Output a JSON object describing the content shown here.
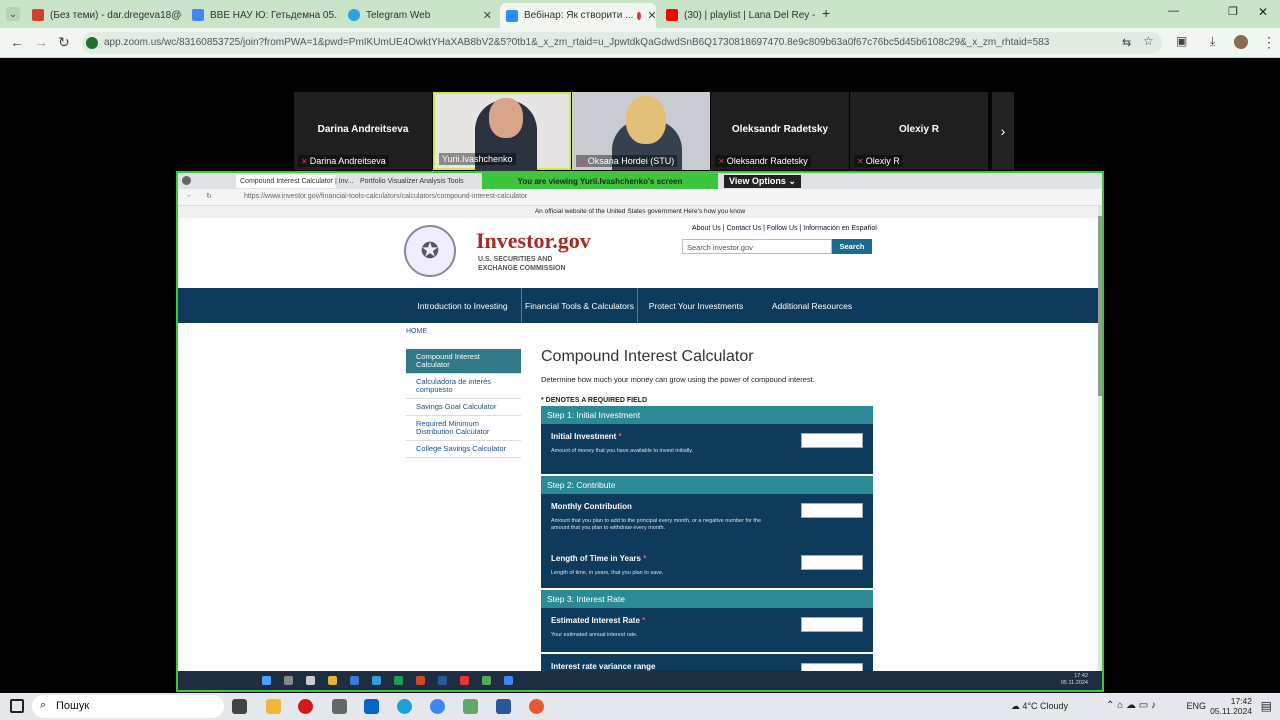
{
  "browser": {
    "tabs": [
      {
        "label": "(Без теми) - dar.dregeva18@g...",
        "color": "#d23f31"
      },
      {
        "label": "ВВЕ НАУ Ю: Гетьдемна 05.11.20...",
        "color": "#4285f4"
      },
      {
        "label": "Telegram Web",
        "color": "#2aa3df"
      },
      {
        "label": "Вебінар: Як створити ...",
        "color": "#2d8cff",
        "active": true
      },
      {
        "label": "(30) | playlist | Lana Del Rey - ...",
        "color": "#ff0000"
      }
    ],
    "url": "app.zoom.us/wc/83160853725/join?fromPWA=1&pwd=PmIKUmUE4OwktYHaXAB8bV2&5?0tb1&_x_zm_rtaid=u_JpwtdkQaGdwdSnB6Q1730818697470.8e9c809b63a0f67c76bc5d45b6108c29&_x_zm_rhtaid=583"
  },
  "zoom": {
    "participants": [
      {
        "name": "Darina Andreitseva",
        "label": "Darina Andreitseva",
        "video": false
      },
      {
        "name": "",
        "label": "Yurii.Ivashchenko",
        "video": true
      },
      {
        "name": "",
        "label": "Oksana Hordei (STU)",
        "video": true
      },
      {
        "name": "Oleksandr Radetsky",
        "label": "Oleksandr Radetsky",
        "video": false
      },
      {
        "name": "Olexiy R",
        "label": "Olexiy R",
        "video": false
      }
    ],
    "viewing_text": "You are viewing  Yurii.Ivashchenko's screen",
    "view_options": "View Options"
  },
  "shared": {
    "inner_tabs": [
      "Compound Interest Calculator | Inv...",
      "Portfolio Visualizer Analysis Tools"
    ],
    "inner_url": "https://www.investor.gov/financial-tools-calculators/calculators/compound-interest-calculator",
    "banner": "An official website of the United States government  Here's how you know",
    "brand": "Investor.gov",
    "brand_sub": "U.S. SECURITIES AND EXCHANGE COMMISSION",
    "top_links": "About Us | Contact Us | Follow Us | Información en Español",
    "search_placeholder": "Search investor.gov",
    "search_button": "Search",
    "nav": [
      "Introduction to Investing",
      "Financial Tools & Calculators",
      "Protect Your Investments",
      "Additional Resources"
    ],
    "breadcrumb": "HOME",
    "sidebar": [
      "Compound Interest Calculator",
      "Calculadora de interés compuesto",
      "Savings Goal Calculator",
      "Required Minimum Distribution Calculator",
      "College Savings Calculator"
    ],
    "title": "Compound Interest Calculator",
    "intro": "Determine how much your money can grow using the power of compound interest.",
    "required": "* DENOTES A REQUIRED FIELD",
    "step1": "Step 1: Initial Investment",
    "f_initial": {
      "label": "Initial Investment",
      "desc": "Amount of money that you have available to invest initially."
    },
    "step2": "Step 2: Contribute",
    "f_monthly": {
      "label": "Monthly Contribution",
      "desc": "Amount that you plan to add to the principal every month, or a negative number for the amount that you plan to withdraw every month."
    },
    "f_length": {
      "label": "Length of Time in Years",
      "desc": "Length of time, in years, that you plan to save."
    },
    "step3": "Step 3: Interest Rate",
    "f_rate": {
      "label": "Estimated Interest Rate",
      "desc": "Your estimated annual interest rate."
    },
    "f_variance": {
      "label": "Interest rate variance range"
    },
    "inner_clock": "17:42",
    "inner_date": "05.11.2024"
  },
  "taskbar": {
    "search": "Пошук",
    "weather": "4°C  Cloudy",
    "lang": "ENG",
    "time": "17:42",
    "date": "05.11.2024"
  }
}
